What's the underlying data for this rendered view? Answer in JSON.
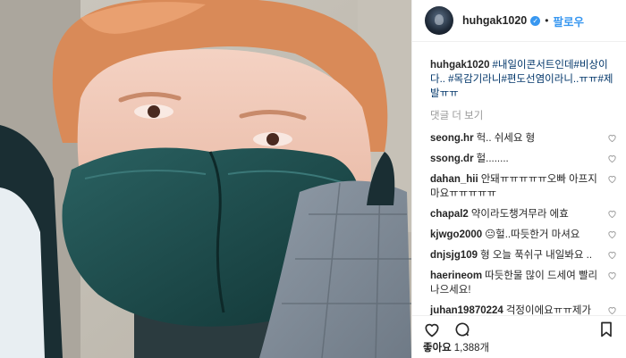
{
  "post": {
    "username": "huhgak1020",
    "verified_mark": "✓",
    "separator": "•",
    "follow_label": "팔로우",
    "caption_user": "huhgak1020",
    "caption_text": "#내일이콘서트인데#비상이다.. #목감기라니#편도선염이라니..ㅠㅠ#제발ㅠㅠ",
    "view_more_label": "댓글 더 보기"
  },
  "comments": [
    {
      "user": "seong.hr",
      "text": "헉.. 쉬세요 형"
    },
    {
      "user": "ssong.dr",
      "text": "헐........"
    },
    {
      "user": "dahan_hii",
      "text": "안돼ㅠㅠㅠㅠㅠ오빠 아프지 마요ㅠㅠㅠㅠㅠ"
    },
    {
      "user": "chapal2",
      "text": "약이라도챙겨무라 에효"
    },
    {
      "user": "kjwgo2000",
      "text": "😐헐..따듯한거 마셔요"
    },
    {
      "user": "dnjsjg109",
      "text": "형 오늘 푹쉬구 내일봐요 .."
    },
    {
      "user": "haerineom",
      "text": "따듯한물 많이 드세여 빨리나으세요!"
    },
    {
      "user": "juhan19870224",
      "text": "걱정이에요ㅠㅠ제가 좋아하는 각이형 편도선염이라니ㅠㅠ 가수의 생명은 목인데ㅠㅠ각이형 아프면 제 맘도 아프고 속상하구요😥각이"
    }
  ],
  "footer": {
    "likes_label": "좋아요",
    "likes_count": "1,388개"
  },
  "icons": {
    "heart": "heart-icon",
    "comment": "comment-icon",
    "share": "share-icon",
    "save": "bookmark-icon"
  },
  "colors": {
    "link_blue": "#3897f0",
    "hashtag": "#003569",
    "mask": "#1f4f4f",
    "hair": "#d98a58"
  }
}
